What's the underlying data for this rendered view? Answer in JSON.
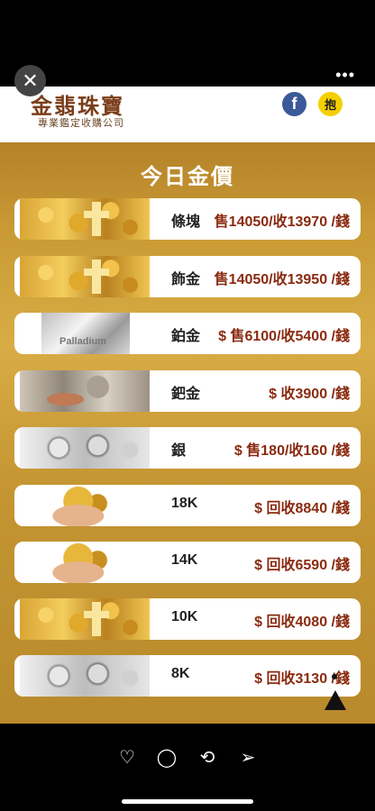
{
  "overlay": {
    "close_glyph": "✕",
    "more_glyph": "•••"
  },
  "header": {
    "brand_name": "金翡珠寶",
    "brand_tagline": "專業鑑定收購公司",
    "facebook_glyph": "f",
    "line_glyph": "抱"
  },
  "board": {
    "title": "今日金價",
    "rows": [
      {
        "label": "條塊",
        "price": "售14050/收13970 /錢"
      },
      {
        "label": "飾金",
        "price": "售14050/收13950 /錢"
      },
      {
        "label": "鉑金",
        "price": "$ 售6100/收5400 /錢"
      },
      {
        "label": "鈀金",
        "price": "$ 收3900 /錢"
      },
      {
        "label": "銀",
        "price": "$ 售180/收160 /錢"
      },
      {
        "label": "18K",
        "price": "$ 回收8840 /錢"
      },
      {
        "label": "14K",
        "price": "$ 回收6590 /錢"
      },
      {
        "label": "10K",
        "price": "$ 回收4080 /錢"
      },
      {
        "label": "8K",
        "price": "$ 回收3130 /錢"
      }
    ],
    "platinum_image_text": "Palladium"
  },
  "actions": {
    "like_glyph": "♡",
    "comment_glyph": "◯",
    "repost_glyph": "⟲",
    "share_glyph": "➢"
  }
}
